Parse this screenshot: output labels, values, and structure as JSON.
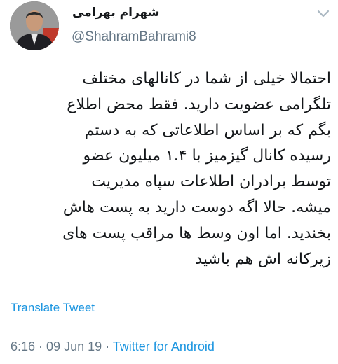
{
  "author": {
    "display_name": "شهرام بهرامی",
    "handle": "@ShahramBahrami8",
    "avatar_icon": "profile-photo"
  },
  "header": {
    "menu_icon": "chevron-down-icon"
  },
  "tweet": {
    "lines": [
      "احتمالا خیلی از شما در کانالهای مختلف",
      "تلگرامی عضویت دارید. فقط محض اطلاع",
      "بگم که بر اساس اطلاعاتی که به دستم",
      "رسیده کانال گیزمیز با ۱.۴ میلیون عضو",
      "توسط برادران اطلاعات سپاه مدیریت",
      "میشه. حالا اگه دوست دارید به پست هاش",
      "بخندید. اما اون وسط ها مراقب پست های",
      "زیرکانه اش هم باشید"
    ],
    "translate_label": "Translate Tweet"
  },
  "meta": {
    "time": "6:16",
    "sep1": " · ",
    "date": "09 Jun 19",
    "sep2": " · ",
    "source": "Twitter for Android"
  },
  "colors": {
    "link": "#1b95e0",
    "secondary": "#657786",
    "text": "#14171a"
  }
}
